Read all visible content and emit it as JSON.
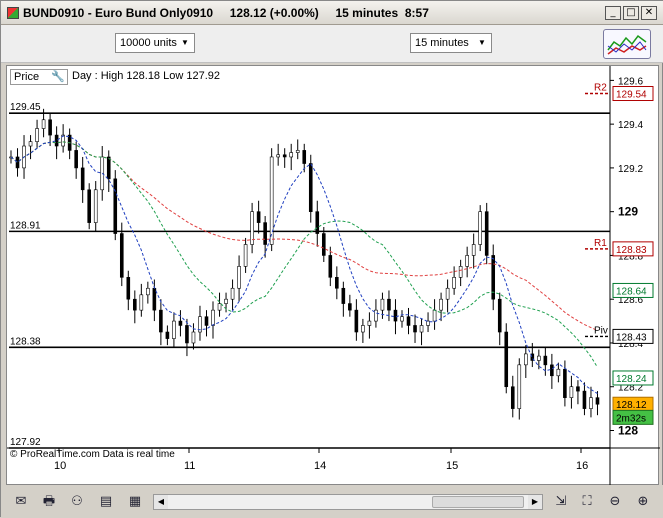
{
  "window": {
    "title": "BUND0910 - Euro Bund Only0910",
    "price": "128.12 (+0.00%)",
    "timeframe_label": "15 minutes",
    "time": "8:57",
    "controls": {
      "minimize": "_",
      "maximize": "□",
      "close": "✕"
    }
  },
  "toolbar": {
    "units_value": "10000 units",
    "interval_value": "15 minutes",
    "indicators_icon": "indicators-chart-icon"
  },
  "chart_header": {
    "price_tab": "Price",
    "settings_icon": "wrench-icon",
    "day_info": "Day : High 128.18 Low 127.92"
  },
  "footer_note": "© ProRealTime.com  Data is real time",
  "chart_data": {
    "type": "line",
    "series": [
      {
        "type": "candlestick",
        "x": [
          0,
          5,
          10,
          15,
          20,
          25,
          30,
          35,
          40,
          45,
          50,
          55,
          60,
          65,
          70,
          75,
          80,
          85,
          90,
          95,
          100,
          105,
          110,
          115,
          120,
          125,
          130,
          135,
          140,
          145,
          150,
          155,
          160,
          165,
          170,
          175,
          180,
          185,
          190,
          195,
          200,
          205,
          210,
          215,
          220,
          225,
          230,
          235,
          240,
          245,
          250,
          255,
          260,
          265,
          270,
          275,
          280,
          285,
          290,
          295,
          300,
          305,
          310,
          315,
          320,
          325,
          330,
          335,
          340,
          345,
          350,
          355,
          360,
          365,
          370,
          375,
          380,
          385,
          390,
          395,
          400,
          405,
          410,
          415,
          420,
          425,
          430,
          435,
          440,
          445,
          450,
          455,
          460,
          465,
          470,
          475,
          480,
          485,
          490,
          495,
          500,
          505,
          510,
          515,
          520,
          525,
          530,
          535,
          540,
          545,
          550,
          555,
          560,
          565,
          570,
          575
        ],
        "close": [
          129.25,
          129.2,
          129.3,
          129.32,
          129.38,
          129.42,
          129.35,
          129.3,
          129.35,
          129.28,
          129.2,
          129.1,
          128.95,
          129.1,
          129.25,
          129.15,
          128.9,
          128.7,
          128.6,
          128.55,
          128.62,
          128.65,
          128.55,
          128.45,
          128.42,
          128.5,
          128.48,
          128.4,
          128.45,
          128.52,
          128.48,
          128.55,
          128.58,
          128.6,
          128.65,
          128.75,
          128.85,
          129.0,
          128.95,
          128.85,
          129.25,
          129.26,
          129.25,
          129.27,
          129.28,
          129.22,
          129.0,
          128.9,
          128.8,
          128.7,
          128.65,
          128.58,
          128.55,
          128.45,
          128.48,
          128.5,
          128.55,
          128.6,
          128.55,
          128.5,
          128.52,
          128.48,
          128.45,
          128.48,
          128.5,
          128.55,
          128.6,
          128.65,
          128.7,
          128.75,
          128.8,
          128.85,
          129.0,
          128.8,
          128.6,
          128.45,
          128.2,
          128.1,
          128.3,
          128.35,
          128.32,
          128.34,
          128.3,
          128.25,
          128.28,
          128.15,
          128.2,
          128.18,
          128.1,
          128.15,
          128.12
        ],
        "name": "Candles"
      }
    ],
    "y_ticks": [
      "129.6",
      "129.4",
      "129.2",
      "129",
      "128.8",
      "128.6",
      "128.4",
      "128.2",
      "128"
    ],
    "x_ticks": [
      "10",
      "11",
      "14",
      "15",
      "16"
    ],
    "ylim": [
      127.92,
      129.62
    ],
    "levels": [
      {
        "label": "129.45",
        "value": 129.45
      },
      {
        "label": "128.91",
        "value": 128.91
      },
      {
        "label": "128.38",
        "value": 128.38
      },
      {
        "label": "127.92",
        "value": 127.92
      }
    ],
    "pivots": [
      {
        "label": "R2",
        "value": 129.54,
        "tag": "129.54",
        "color": "#b00000"
      },
      {
        "label": "R1",
        "value": 128.83,
        "tag": "128.83",
        "color": "#b00000"
      },
      {
        "label": "Piv",
        "value": 128.43,
        "tag": "128.43",
        "color": "#000000"
      }
    ],
    "axis_tags": [
      {
        "value": 128.64,
        "text": "128.64",
        "bg": "#ffffff",
        "fg": "#007a2e",
        "border": "#007a2e"
      },
      {
        "value": 128.24,
        "text": "128.24",
        "bg": "#ffffff",
        "fg": "#007a2e",
        "border": "#007a2e"
      },
      {
        "value": 128.12,
        "text": "128.12",
        "bg": "#ffb000",
        "fg": "#000000",
        "border": "#b07000"
      },
      {
        "value": 128.06,
        "text": "2m32s",
        "bg": "#44c044",
        "fg": "#000000",
        "border": "#207020"
      }
    ],
    "moving_averages": [
      {
        "name": "MA-slow",
        "color": "#e04040"
      },
      {
        "name": "MA-mid",
        "color": "#20a050"
      },
      {
        "name": "MA-fast",
        "color": "#2040c0"
      }
    ]
  }
}
